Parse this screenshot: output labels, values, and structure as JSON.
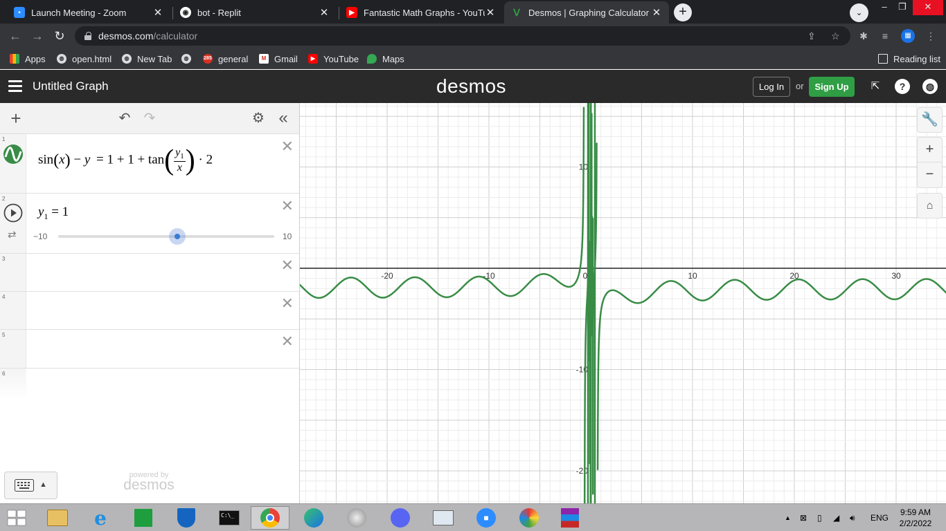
{
  "browser": {
    "tabs": [
      {
        "title": "Launch Meeting - Zoom",
        "icon": "zoom-icon",
        "color": "#2d8cff"
      },
      {
        "title": "bot - Replit",
        "icon": "replit-icon",
        "color": "#ffffff"
      },
      {
        "title": "Fantastic Math Graphs - YouTube",
        "icon": "youtube-icon",
        "color": "#ff0000"
      },
      {
        "title": "Desmos | Graphing Calculator",
        "icon": "desmos-icon",
        "color": "#2f9e44"
      }
    ],
    "close_glyph": "✕",
    "new_tab_glyph": "+",
    "url_host": "desmos.com",
    "url_path": "/calculator",
    "bookmarks": [
      {
        "label": "Apps"
      },
      {
        "label": "open.html"
      },
      {
        "label": "New Tab"
      },
      {
        "label": "general",
        "badge": "285"
      },
      {
        "label": "Gmail"
      },
      {
        "label": "YouTube"
      },
      {
        "label": "Maps"
      }
    ],
    "reading_list": "Reading list"
  },
  "desmos": {
    "graph_title": "Untitled Graph",
    "logo": "desmos",
    "login_label": "Log In",
    "or_label": "or",
    "signup_label": "Sign Up",
    "brand_green": "#2f9e44",
    "curve_color": "#388c46"
  },
  "expressions": {
    "rows": [
      {
        "number": "1"
      },
      {
        "number": "2"
      },
      {
        "number": "3"
      },
      {
        "number": "4"
      },
      {
        "number": "5"
      },
      {
        "number": "6"
      }
    ],
    "expr1": {
      "sin": "sin",
      "x": "x",
      "minus": "−",
      "y": "y",
      "equals": "=",
      "rhs": "1 + 1 + tan",
      "frac_num": "y",
      "frac_num_sub": "1",
      "frac_den": "x",
      "tail": "· 2"
    },
    "expr2": {
      "var": "y",
      "sub": "1",
      "equals": "= 1",
      "slider_min": "−10",
      "slider_max": "10",
      "slider_value": 1,
      "slider_range": [
        -10,
        10
      ]
    },
    "powered_by": "powered by",
    "powered_logo": "desmos"
  },
  "graph": {
    "x_ticks": [
      "-20",
      "-10",
      "0",
      "10",
      "20",
      "30"
    ],
    "y_ticks": [
      "10",
      "-10",
      "-20"
    ]
  },
  "taskbar": {
    "language": "ENG",
    "time": "9:59 AM",
    "date": "2/2/2022"
  }
}
